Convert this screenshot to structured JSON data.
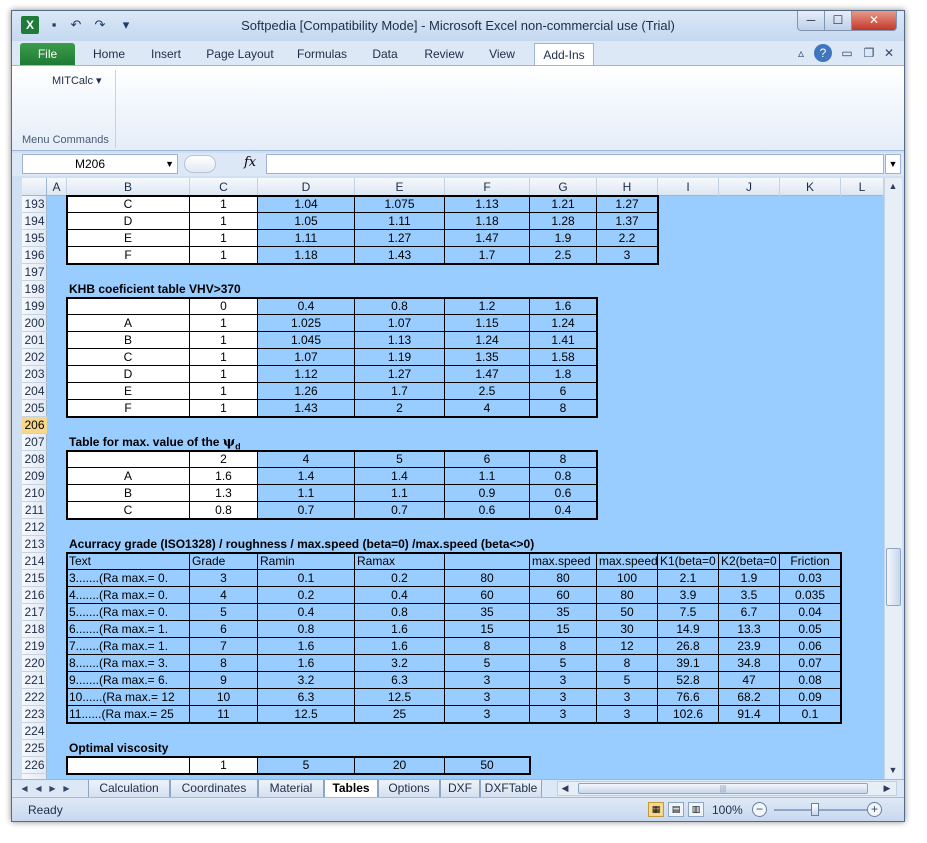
{
  "window": {
    "title": "Softpedia  [Compatibility Mode]  -  Microsoft Excel non-commercial use (Trial)",
    "app_icon": "excel-icon",
    "quick_access": [
      "save-icon",
      "undo-icon",
      "redo-icon",
      "customize-icon"
    ],
    "controls": {
      "minimize": "─",
      "maximize": "☐",
      "close": "✕"
    }
  },
  "ribbon": {
    "tabs": [
      "File",
      "Home",
      "Insert",
      "Page Layout",
      "Formulas",
      "Data",
      "Review",
      "View",
      "Add-Ins"
    ],
    "active_tab": "Add-Ins",
    "addin_menu": "MITCalc ▾",
    "group_label": "Menu Commands"
  },
  "formula_bar": {
    "name_box": "M206",
    "fx_label": "fx",
    "formula": ""
  },
  "grid": {
    "columns": [
      "A",
      "B",
      "C",
      "D",
      "E",
      "F",
      "G",
      "H",
      "I",
      "J",
      "K",
      "L"
    ],
    "rows": [
      "193",
      "194",
      "195",
      "196",
      "197",
      "198",
      "199",
      "200",
      "201",
      "202",
      "203",
      "204",
      "205",
      "206",
      "207",
      "208",
      "209",
      "210",
      "211",
      "212",
      "213",
      "214",
      "215",
      "216",
      "217",
      "218",
      "219",
      "220",
      "221",
      "222",
      "223",
      "224",
      "225",
      "226"
    ],
    "active_row": "206",
    "table1": {
      "rows": [
        [
          "C",
          "1",
          "1.04",
          "1.075",
          "1.13",
          "1.21",
          "1.27"
        ],
        [
          "D",
          "1",
          "1.05",
          "1.11",
          "1.18",
          "1.28",
          "1.37"
        ],
        [
          "E",
          "1",
          "1.11",
          "1.27",
          "1.47",
          "1.9",
          "2.2"
        ],
        [
          "F",
          "1",
          "1.18",
          "1.43",
          "1.7",
          "2.5",
          "3"
        ]
      ]
    },
    "table2": {
      "title": "KHB coeficient table VHV>370",
      "header": [
        "",
        "0",
        "0.4",
        "0.8",
        "1.2",
        "1.6"
      ],
      "rows": [
        [
          "A",
          "1",
          "1.025",
          "1.07",
          "1.15",
          "1.24"
        ],
        [
          "B",
          "1",
          "1.045",
          "1.13",
          "1.24",
          "1.41"
        ],
        [
          "C",
          "1",
          "1.07",
          "1.19",
          "1.35",
          "1.58"
        ],
        [
          "D",
          "1",
          "1.12",
          "1.27",
          "1.47",
          "1.8"
        ],
        [
          "E",
          "1",
          "1.26",
          "1.7",
          "2.5",
          "6"
        ],
        [
          "F",
          "1",
          "1.43",
          "2",
          "4",
          "8"
        ]
      ]
    },
    "table3": {
      "title": "Table for max. value of the ",
      "title_symbol": "ψ",
      "title_sub": "d",
      "header": [
        "",
        "2",
        "4",
        "5",
        "6",
        "8"
      ],
      "rows": [
        [
          "A",
          "1.6",
          "1.4",
          "1.4",
          "1.1",
          "0.8"
        ],
        [
          "B",
          "1.3",
          "1.1",
          "1.1",
          "0.9",
          "0.6"
        ],
        [
          "C",
          "0.8",
          "0.7",
          "0.7",
          "0.6",
          "0.4"
        ]
      ]
    },
    "table4": {
      "title": "Acurracy grade (ISO1328) / roughness / max.speed (beta=0) /max.speed (beta<>0)",
      "header": [
        "Text",
        "Grade",
        "Ramin",
        "Ramax",
        "",
        "max.speed",
        "max.speed",
        "K1(beta=0",
        "K2(beta=0",
        "Friction"
      ],
      "rows": [
        [
          "3.......(Ra max.= 0.",
          "3",
          "0.1",
          "0.2",
          "80",
          "80",
          "100",
          "2.1",
          "1.9",
          "0.03"
        ],
        [
          "4.......(Ra max.= 0.",
          "4",
          "0.2",
          "0.4",
          "60",
          "60",
          "80",
          "3.9",
          "3.5",
          "0.035"
        ],
        [
          "5.......(Ra max.= 0.",
          "5",
          "0.4",
          "0.8",
          "35",
          "35",
          "50",
          "7.5",
          "6.7",
          "0.04"
        ],
        [
          "6.......(Ra max.= 1.",
          "6",
          "0.8",
          "1.6",
          "15",
          "15",
          "30",
          "14.9",
          "13.3",
          "0.05"
        ],
        [
          "7.......(Ra max.= 1.",
          "7",
          "1.6",
          "1.6",
          "8",
          "8",
          "12",
          "26.8",
          "23.9",
          "0.06"
        ],
        [
          "8.......(Ra max.= 3.",
          "8",
          "1.6",
          "3.2",
          "5",
          "5",
          "8",
          "39.1",
          "34.8",
          "0.07"
        ],
        [
          "9.......(Ra max.= 6.",
          "9",
          "3.2",
          "6.3",
          "3",
          "3",
          "5",
          "52.8",
          "47",
          "0.08"
        ],
        [
          "10......(Ra max.= 12",
          "10",
          "6.3",
          "12.5",
          "3",
          "3",
          "3",
          "76.6",
          "68.2",
          "0.09"
        ],
        [
          "11......(Ra max.= 25",
          "11",
          "12.5",
          "25",
          "3",
          "3",
          "3",
          "102.6",
          "91.4",
          "0.1"
        ]
      ]
    },
    "table5": {
      "title": "Optimal viscosity",
      "header": [
        "",
        "1",
        "5",
        "20",
        "50"
      ]
    }
  },
  "sheets": {
    "tabs": [
      "Calculation",
      "Coordinates",
      "Material",
      "Tables",
      "Options",
      "DXF",
      "DXFTable"
    ],
    "active": "Tables"
  },
  "status": {
    "ready": "Ready",
    "zoom": "100%"
  }
}
